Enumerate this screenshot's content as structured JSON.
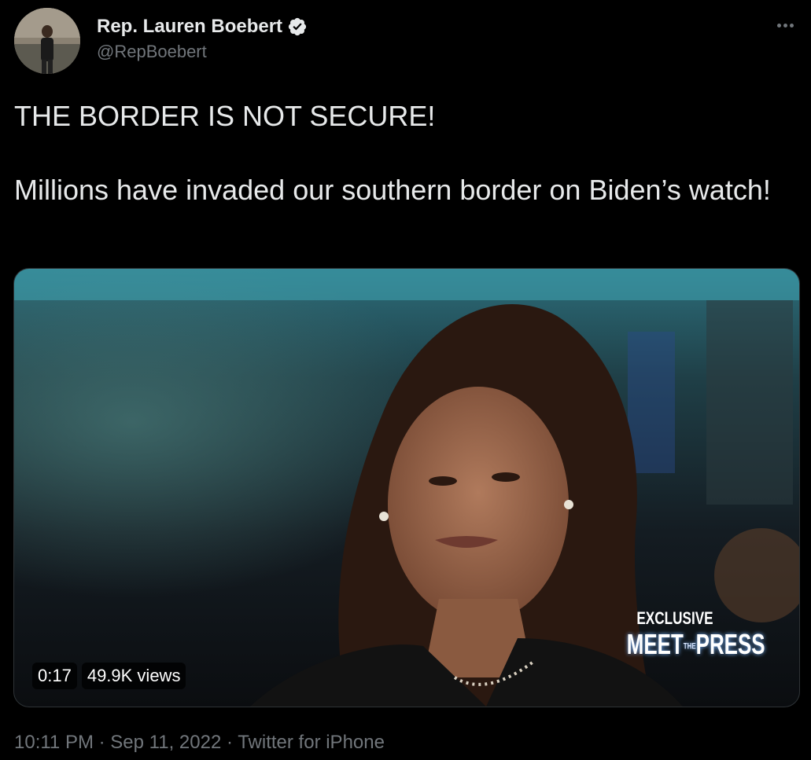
{
  "author": {
    "display_name": "Rep. Lauren Boebert",
    "handle": "@RepBoebert",
    "verified": true,
    "avatar_icon": "profile-photo"
  },
  "tweet": {
    "paragraphs": [
      "THE BORDER IS NOT SECURE!",
      "Millions have invaded our southern border on Biden’s watch!"
    ]
  },
  "media": {
    "duration": "0:17",
    "views": "49.9K views",
    "logo_line1": "EXCLUSIVE",
    "logo_brand_left": "MEET",
    "logo_brand_the": "THE",
    "logo_brand_right": "PRESS"
  },
  "meta": {
    "time": "10:11 PM",
    "separator1": " · ",
    "date": "Sep 11, 2022",
    "separator2": " · ",
    "source": "Twitter for iPhone"
  },
  "colors": {
    "background": "#000000",
    "text": "#e7e9ea",
    "secondary": "#71767b",
    "border": "#2f3336"
  }
}
